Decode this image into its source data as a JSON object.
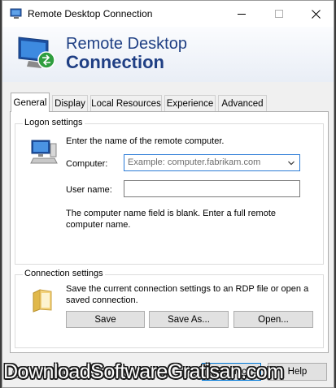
{
  "window": {
    "title": "Remote Desktop Connection"
  },
  "banner": {
    "line1": "Remote Desktop",
    "line2": "Connection"
  },
  "tabs": [
    {
      "label": "General",
      "active": true
    },
    {
      "label": "Display"
    },
    {
      "label": "Local Resources"
    },
    {
      "label": "Experience"
    },
    {
      "label": "Advanced"
    }
  ],
  "logon": {
    "group_label": "Logon settings",
    "intro": "Enter the name of the remote computer.",
    "computer_label": "Computer:",
    "computer_placeholder": "Example: computer.fabrikam.com",
    "username_label": "User name:",
    "username_value": "",
    "message": "The computer name field is blank. Enter a full remote computer name."
  },
  "connection": {
    "group_label": "Connection settings",
    "description": "Save the current connection settings to an RDP file or open a saved connection.",
    "save_label": "Save",
    "save_as_label": "Save As...",
    "open_label": "Open..."
  },
  "footer": {
    "hide_options_label": "Hide Options",
    "connect_label": "Connect",
    "help_label": "Help"
  },
  "watermark": "DownloadSoftwareGratisan.com",
  "colors": {
    "banner_text": "#1f3f84",
    "focus_border": "#2b7bd6"
  }
}
